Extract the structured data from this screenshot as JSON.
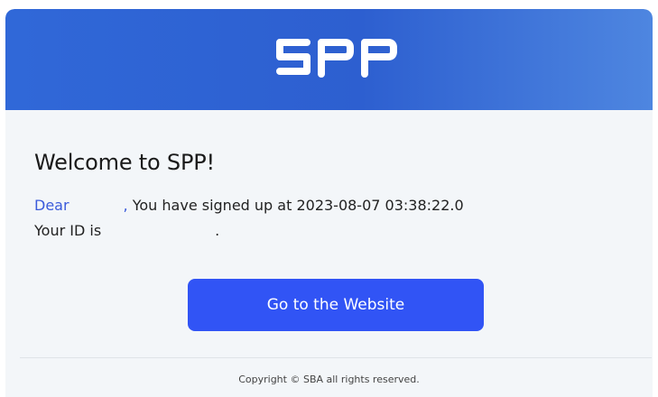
{
  "brand": {
    "logo_text": "SPP",
    "header_colors": [
      "#3068d8",
      "#4e86e0"
    ],
    "logo_color": "#ffffff"
  },
  "content": {
    "title": "Welcome to SPP!",
    "greeting": "Dear",
    "comma": ",",
    "signup_text": "You have signed up at 2023-08-07 03:38:22.0",
    "id_prefix": "Your ID is",
    "id_suffix": "."
  },
  "button": {
    "label": "Go to the Website",
    "color": "#3154f5"
  },
  "footer": {
    "copyright": "Copyright © SBA all rights reserved."
  }
}
